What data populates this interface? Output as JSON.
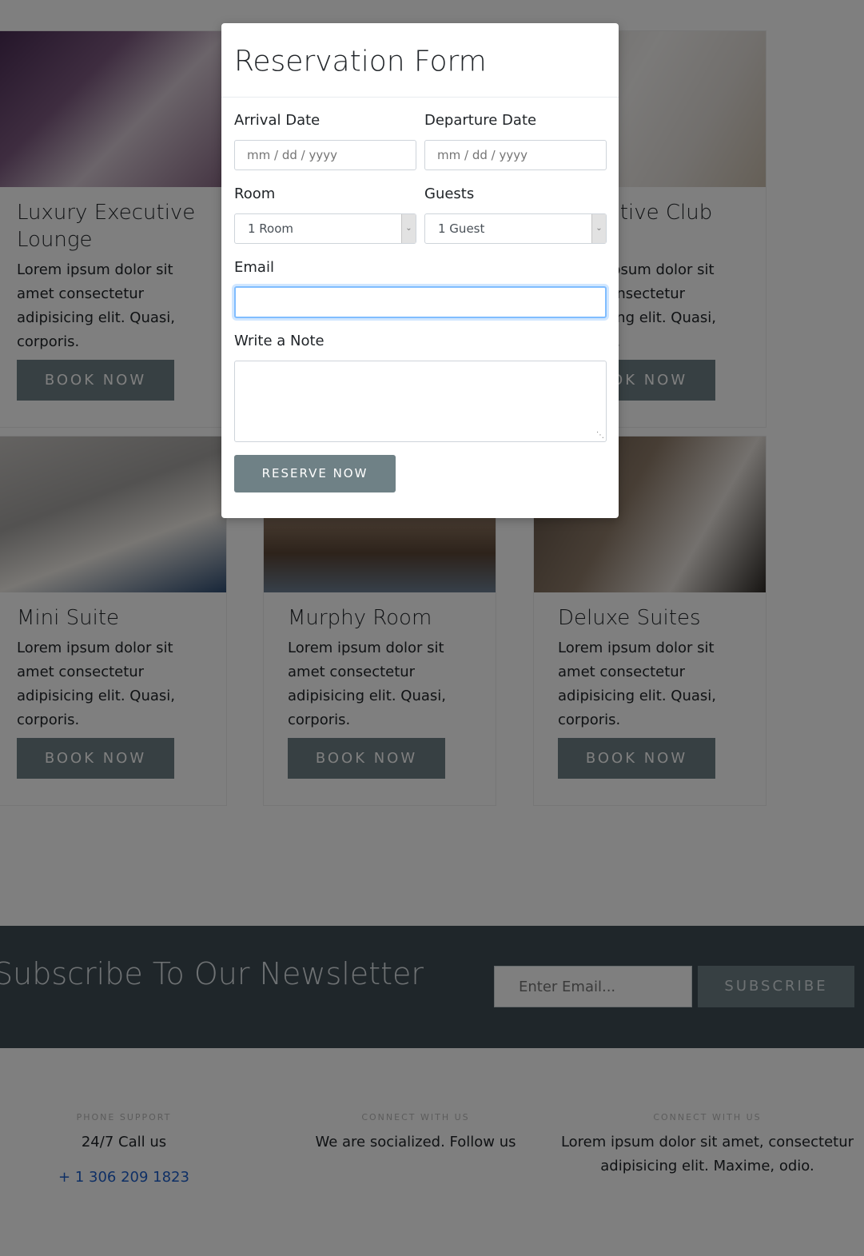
{
  "rooms": [
    {
      "title": "Luxury Executive Lounge",
      "desc": "Lorem ipsum dolor sit amet consectetur adipisicing elit. Quasi, corporis.",
      "button": "BOOK NOW"
    },
    {
      "title": "Executive Club",
      "desc": "Lorem ipsum dolor sit amet consectetur adipisicing elit. Quasi, corporis.",
      "button": "BOOK NOW"
    },
    {
      "title": "Mini Suite",
      "desc": "Lorem ipsum dolor sit amet consectetur adipisicing elit. Quasi, corporis.",
      "button": "BOOK NOW"
    },
    {
      "title": "Murphy Room",
      "desc": "Lorem ipsum dolor sit amet consectetur adipisicing elit. Quasi, corporis.",
      "button": "BOOK NOW"
    },
    {
      "title": "Deluxe Suites",
      "desc": "Lorem ipsum dolor sit amet consectetur adipisicing elit. Quasi, corporis.",
      "button": "BOOK NOW"
    }
  ],
  "newsletter": {
    "heading": "Subscribe To Our Newsletter",
    "email_placeholder": "Enter Email...",
    "button": "SUBSCRIBE"
  },
  "footer": {
    "phone": {
      "eyebrow": "PHONE SUPPORT",
      "line": "24/7 Call us",
      "number": "+ 1 306 209 1823"
    },
    "social": {
      "eyebrow": "CONNECT WITH US",
      "line": "We are socialized. Follow us"
    },
    "about": {
      "eyebrow": "CONNECT WITH US",
      "line": "Lorem ipsum dolor sit amet, consectetur adipisicing elit. Maxime, odio."
    }
  },
  "modal": {
    "title": "Reservation Form",
    "arrival_label": "Arrival Date",
    "arrival_placeholder": "mm / dd / yyyy",
    "departure_label": "Departure Date",
    "departure_placeholder": "mm / dd / yyyy",
    "room_label": "Room",
    "room_value": "1 Room",
    "guests_label": "Guests",
    "guests_value": "1 Guest",
    "email_label": "Email",
    "email_value": "",
    "note_label": "Write a Note",
    "note_value": "",
    "submit": "RESERVE NOW"
  },
  "colors": {
    "accent": "#6f8186",
    "newsletter_bg": "#3f4d55",
    "link": "#1d5fcb",
    "focus": "#80bdff"
  },
  "icons": {
    "select_arrow": "chevron-down-icon",
    "textarea_grip": "resize-grip-icon"
  }
}
